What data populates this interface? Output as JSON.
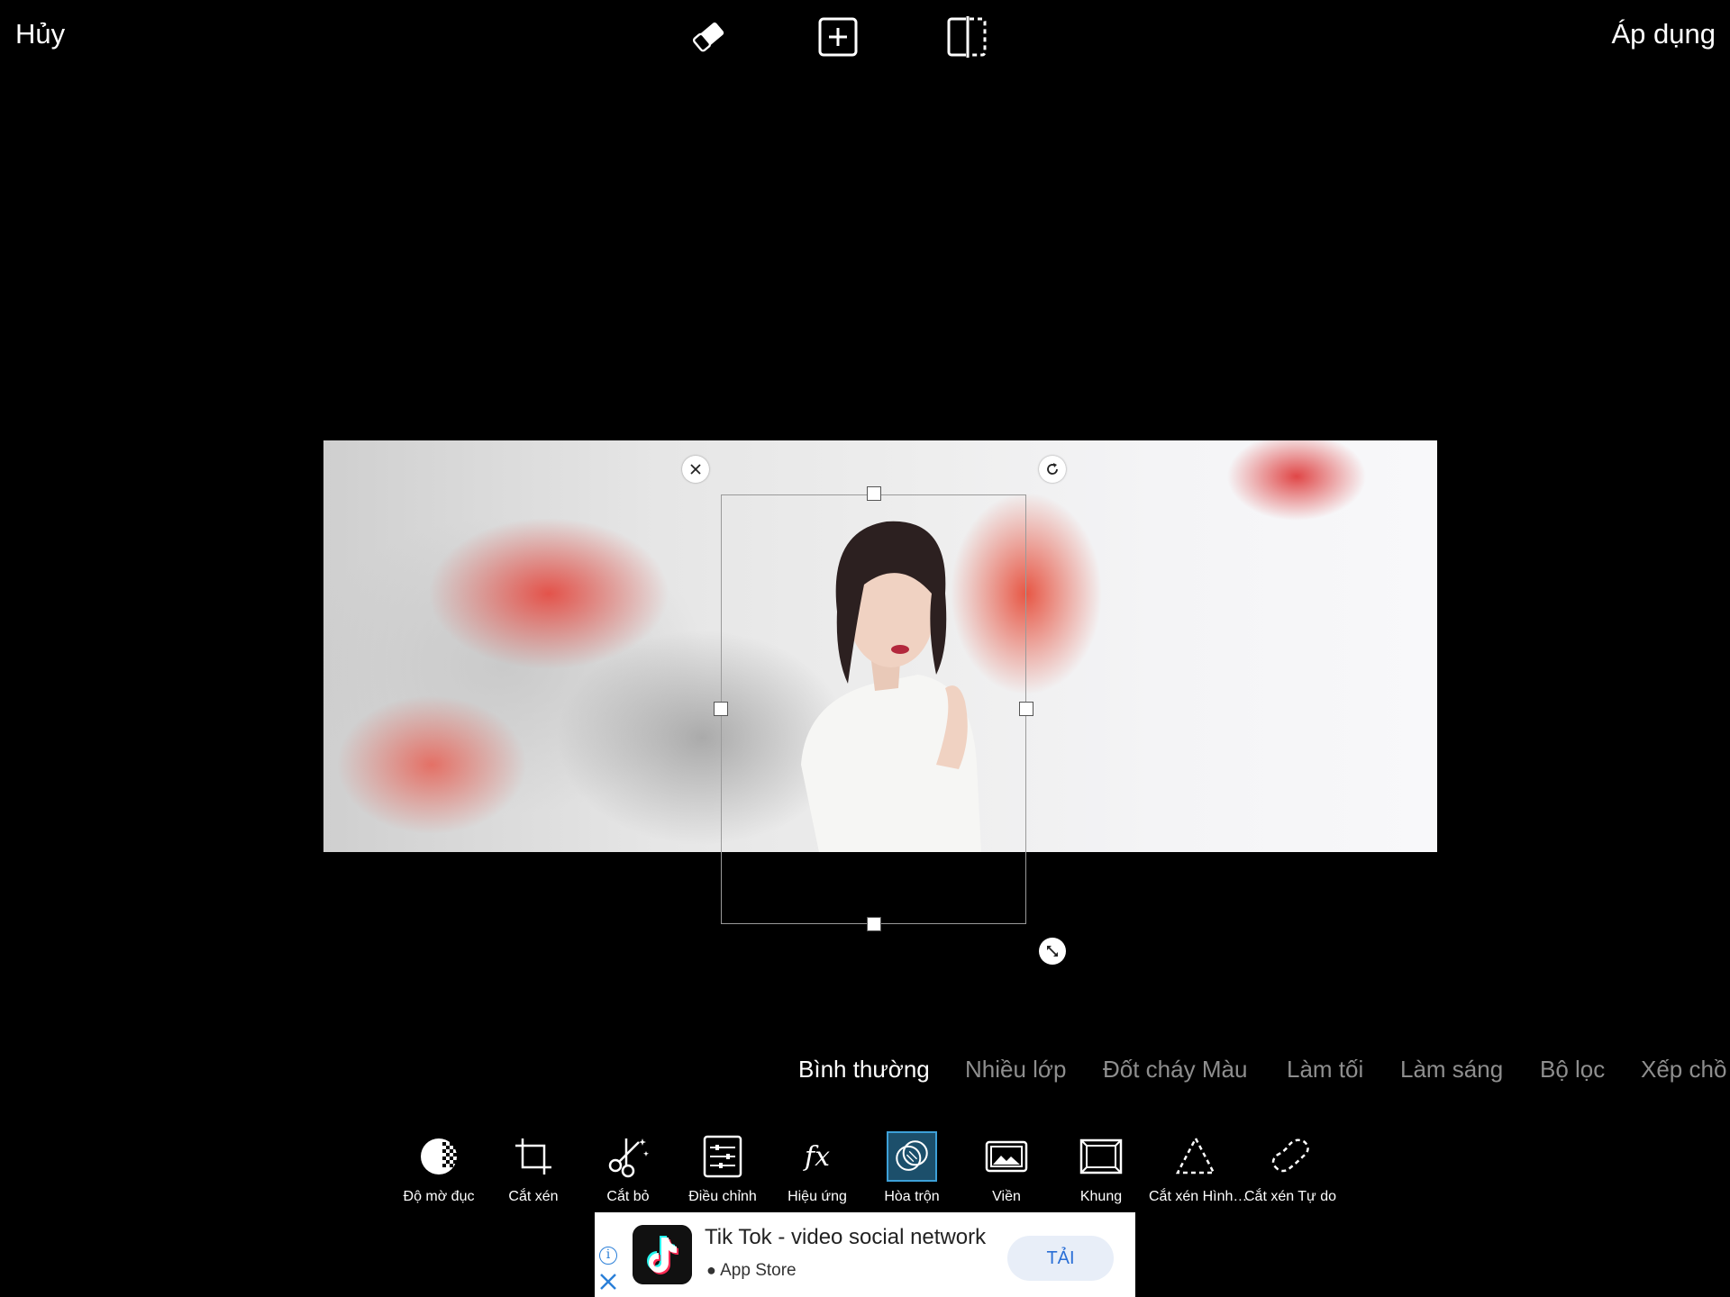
{
  "topbar": {
    "cancel_label": "Hủy",
    "apply_label": "Áp dụng",
    "icons": [
      "eraser-icon",
      "add-layer-icon",
      "flip-icon"
    ]
  },
  "blend_modes": {
    "items": [
      "Bình thường",
      "Nhiều lớp",
      "Đốt cháy Màu",
      "Làm tối",
      "Làm sáng",
      "Bộ lọc",
      "Xếp chồ"
    ],
    "selected": "Bình thường"
  },
  "tools": {
    "items": [
      {
        "label": "Độ mờ đục",
        "icon": "opacity-icon"
      },
      {
        "label": "Cắt xén",
        "icon": "crop-icon"
      },
      {
        "label": "Cắt bỏ",
        "icon": "cutout-icon"
      },
      {
        "label": "Điều chỉnh",
        "icon": "adjust-icon"
      },
      {
        "label": "Hiệu ứng",
        "icon": "effects-icon"
      },
      {
        "label": "Hòa trộn",
        "icon": "blend-icon"
      },
      {
        "label": "Viền",
        "icon": "border-icon"
      },
      {
        "label": "Khung",
        "icon": "frame-icon"
      },
      {
        "label": "Cắt xén Hình…",
        "icon": "shape-crop-icon"
      },
      {
        "label": "Cắt xén Tự do",
        "icon": "free-crop-icon"
      }
    ],
    "selected": "Hòa trộn"
  },
  "ad": {
    "title": "Tik Tok - video social network",
    "store": "App Store",
    "button": "TẢI"
  },
  "colors": {
    "background": "#000000",
    "accent": "#3da0d8",
    "inactive_text": "#8e8e8e"
  }
}
